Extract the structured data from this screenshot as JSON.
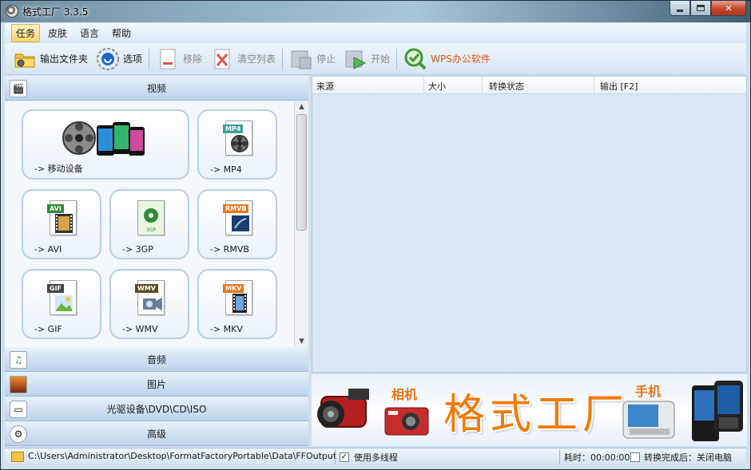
{
  "window": {
    "title": "格式工厂 3.3.5"
  },
  "menu": [
    "任务",
    "皮肤",
    "语言",
    "帮助"
  ],
  "toolbar": {
    "output_folder": "输出文件夹",
    "options": "选项",
    "remove": "移除",
    "clear_list": "清空列表",
    "stop": "停止",
    "start": "开始",
    "wps": "WPS办公软件"
  },
  "categories": {
    "video": "视频",
    "audio": "音频",
    "picture": "图片",
    "rom": "光驱设备\\DVD\\CD\\ISO",
    "advanced": "高级"
  },
  "formats": {
    "mobile": "-> 移动设备",
    "mp4": "-> MP4",
    "avi": "-> AVI",
    "threegp": "-> 3GP",
    "rmvb": "-> RMVB",
    "gif": "-> GIF",
    "wmv": "-> WMV",
    "mkv": "-> MKV"
  },
  "format_tags": {
    "mp4": "MP4",
    "avi": "AVI",
    "threegp": "3GP",
    "rmvb": "RMVB",
    "gif": "GIF",
    "wmv": "WMV",
    "mkv": "MKV"
  },
  "task_table": {
    "columns": [
      "来源",
      "大小",
      "转换状态",
      "输出 [F2]"
    ]
  },
  "banner": {
    "camera": "相机",
    "brand": "格式工厂",
    "phone": "手机"
  },
  "status": {
    "output_path": "C:\\Users\\Administrator\\Desktop\\FormatFactoryPortable\\Data\\FFOutput",
    "multithread_label": "使用多线程",
    "multithread_checked": true,
    "elapsed": "耗时：00:00:00",
    "after_done": "转换完成后：关闭电脑",
    "after_done_checked": false
  },
  "colors": {
    "brand_orange": "#f57a00",
    "wps_orange": "#e35a12",
    "panel_blue": "#dbe7f5"
  }
}
